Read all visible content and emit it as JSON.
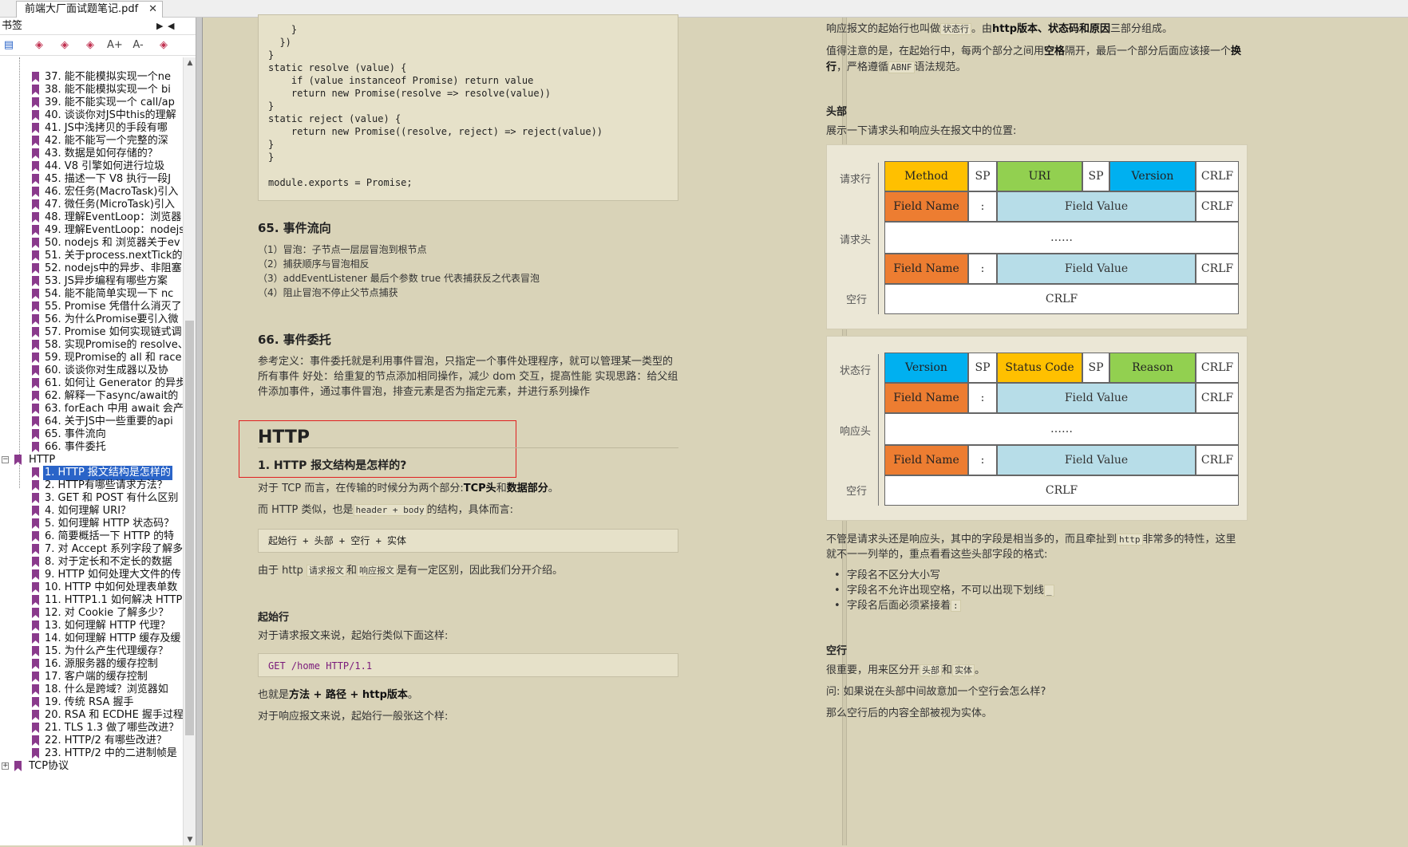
{
  "tab": {
    "title": "前端大厂面试题笔记.pdf",
    "close": "✕"
  },
  "sidebar": {
    "title": "书签",
    "collapse": "▶",
    "pin": "◀",
    "tools": [
      "▤",
      "◈",
      "◈",
      "◈",
      "A+",
      "A-",
      "◈"
    ],
    "items": [
      "37. 能不能模拟实现一个ne",
      "38. 能不能模拟实现一个 bi",
      "39. 能不能实现一个 call/ap",
      "40. 谈谈你对JS中this的理解",
      "41. JS中浅拷贝的手段有哪",
      "42. 能不能写一个完整的深",
      "43. 数据是如何存储的？",
      "44. V8 引擎如何进行垃圾",
      "45. 描述一下 V8 执行一段J",
      "46. 宏任务(MacroTask)引入",
      "47. 微任务(MicroTask)引入",
      "48. 理解EventLoop：浏览器",
      "49. 理解EventLoop：nodejs",
      "50. nodejs 和 浏览器关于ev",
      "51. 关于process.nextTick的",
      "52. nodejs中的异步、非阻塞",
      "53. JS异步编程有哪些方案",
      "54. 能不能简单实现一下 nc",
      "55. Promise 凭借什么消灭了",
      "56. 为什么Promise要引入微",
      "57. Promise 如何实现链式调",
      "58. 实现Promise的 resolve、",
      "59. 现Promise的 all 和 race",
      "60. 谈谈你对生成器以及协",
      "61. 如何让 Generator 的异步",
      "62. 解释一下async/await的",
      "63. forEach 中用 await 会产生",
      "64. 关于JS中一些重要的api",
      "65. 事件流向",
      "66. 事件委托"
    ],
    "section": {
      "label": "HTTP",
      "toggle": "−"
    },
    "http_items": [
      "1. HTTP 报文结构是怎样的",
      "2. HTTP有哪些请求方法？",
      "3. GET 和 POST 有什么区别",
      "4. 如何理解 URI？",
      "5. 如何理解 HTTP 状态码？",
      "6. 简要概括一下 HTTP 的特",
      "7. 对 Accept 系列字段了解多",
      "8. 对于定长和不定长的数据",
      "9. HTTP 如何处理大文件的传",
      "10. HTTP 中如何处理表单数",
      "11. HTTP1.1 如何解决 HTTP",
      "12.  对 Cookie 了解多少？",
      "13. 如何理解 HTTP 代理？",
      "14. 如何理解 HTTP 缓存及缓",
      "15. 为什么产生代理缓存？",
      "16. 源服务器的缓存控制",
      "17. 客户端的缓存控制",
      "18. 什么是跨域？浏览器如",
      "19. 传统 RSA 握手",
      "20. RSA 和 ECDHE 握手过程",
      "21. TLS 1.3 做了哪些改进？",
      "22. HTTP/2 有哪些改进？",
      "23. HTTP/2 中的二进制帧是"
    ],
    "next_section": "TCP协议",
    "scroll_up": "▲",
    "scroll_down": "▼"
  },
  "left_page": {
    "code_top": [
      "    }",
      "  })",
      "}",
      "static resolve (value) {",
      "    if (value instanceof Promise) return value",
      "    return new Promise(resolve => resolve(value))",
      "}",
      "static reject (value) {",
      "    return new Promise((resolve, reject) => reject(value))",
      "}",
      "}",
      "",
      "module.exports = Promise;"
    ],
    "h65": "65. 事件流向",
    "list65": [
      "（1）冒泡：子节点一层层冒泡到根节点",
      "（2）捕获顺序与冒泡相反",
      "（3）addEventListener 最后个参数 true 代表捕获反之代表冒泡",
      "（4）阻止冒泡不停止父节点捕获"
    ],
    "h66": "66. 事件委托",
    "p66": "参考定义：事件委托就是利用事件冒泡，只指定一个事件处理程序，就可以管理某一类型的所有事件 好处：给重复的节点添加相同操作，减少 dom 交互，提高性能 实现思路：给父组件添加事件，通过事件冒泡，排查元素是否为指定元素，并进行系列操作",
    "http_title": "HTTP",
    "q1": "1. HTTP 报文结构是怎样的?",
    "p1a": "对于 TCP 而言，在传输的时候分为两个部分:",
    "p1a_b1": "TCP头",
    "p1a_and": "和",
    "p1a_b2": "数据部分",
    "p1a_end": "。",
    "p1b_pre": "而 HTTP 类似，也是",
    "p1b_code": "header + body",
    "p1b_post": "的结构，具体而言:",
    "code_struct": "起始行 + 头部 + 空行 + 实体",
    "p1c_pre": "由于 http ",
    "p1c_c1": "请求报文",
    "p1c_and": "和",
    "p1c_c2": "响应报文",
    "p1c_post": "是有一定区别，因此我们分开介绍。",
    "h_start": "起始行",
    "p_start": "对于请求报文来说，起始行类似下面这样:",
    "code_get": "GET /home HTTP/1.1",
    "p_also_pre": "也就是",
    "p_also_b": "方法 + 路径 + http版本",
    "p_also_end": "。",
    "p_resp": "对于响应报文来说，起始行一般张这个样:"
  },
  "right_page": {
    "p_top1_pre": "响应报文的起始行也叫做",
    "p_top1_code": "状态行",
    "p_top1_mid": "。由",
    "p_top1_b": "http版本、状态码和原因",
    "p_top1_end": "三部分组成。",
    "p_top2_pre": "值得注意的是，在起始行中，每两个部分之间用",
    "p_top2_b1": "空格",
    "p_top2_mid": "隔开，最后一个部分后面应该接一个",
    "p_top2_b2": "换行",
    "p_top2_mid2": "，严格遵循",
    "p_top2_code": "ABNF",
    "p_top2_end": "语法规范。",
    "h_head": "头部",
    "p_head": "展示一下请求头和响应头在报文中的位置:",
    "req": {
      "label_line": "请求行",
      "label_head": "请求头",
      "label_blank": "空行",
      "method": "Method",
      "sp": "SP",
      "uri": "URI",
      "version": "Version",
      "crlf": "CRLF",
      "field_name": "Field Name",
      "colon": ":",
      "field_value": "Field Value",
      "dots": "……"
    },
    "res": {
      "label_line": "状态行",
      "label_head": "响应头",
      "label_blank": "空行",
      "version": "Version",
      "sp": "SP",
      "status": "Status Code",
      "reason": "Reason",
      "crlf": "CRLF",
      "field_name": "Field Name",
      "colon": ":",
      "field_value": "Field Value",
      "dots": "……"
    },
    "p_fields_pre": "不管是请求头还是响应头，其中的字段是相当多的，而且牵扯到",
    "p_fields_code": "http",
    "p_fields_post": "非常多的特性，这里就不一一列举的，重点看看这些头部字段的格式:",
    "bullets": [
      "字段名不区分大小写",
      "字段名不允许出现空格，不可以出现下划线",
      "字段名后面必须紧接着"
    ],
    "bullet2_code": "_",
    "bullet3_code": ":",
    "h_blank": "空行",
    "p_blank_pre": "很重要，用来区分开",
    "p_blank_c1": "头部",
    "p_blank_and": "和",
    "p_blank_c2": "实体",
    "p_blank_end": "。",
    "p_q": "问: 如果说在头部中间故意加一个空行会怎么样?",
    "p_a": "那么空行后的内容全部被视为实体。"
  }
}
